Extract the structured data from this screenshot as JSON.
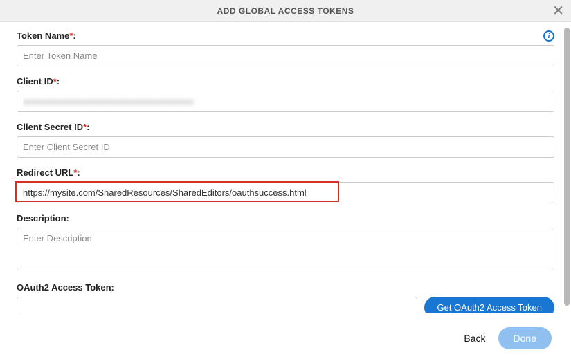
{
  "header": {
    "title": "ADD GLOBAL ACCESS TOKENS"
  },
  "fields": {
    "token_name": {
      "label": "Token Name",
      "placeholder": "Enter Token Name",
      "value": ""
    },
    "client_id": {
      "label": "Client ID",
      "placeholder": "",
      "value": ""
    },
    "client_secret": {
      "label": "Client Secret ID",
      "placeholder": "Enter Client Secret ID",
      "value": ""
    },
    "redirect_url": {
      "label": "Redirect URL",
      "placeholder": "",
      "value": "https://mysite.com/SharedResources/SharedEditors/oauthsuccess.html"
    },
    "description": {
      "label": "Description:",
      "placeholder": "Enter Description",
      "value": ""
    },
    "oauth_token": {
      "label": "OAuth2 Access Token:",
      "value": ""
    }
  },
  "buttons": {
    "get_token": "Get OAuth2 Access Token",
    "back": "Back",
    "done": "Done"
  }
}
